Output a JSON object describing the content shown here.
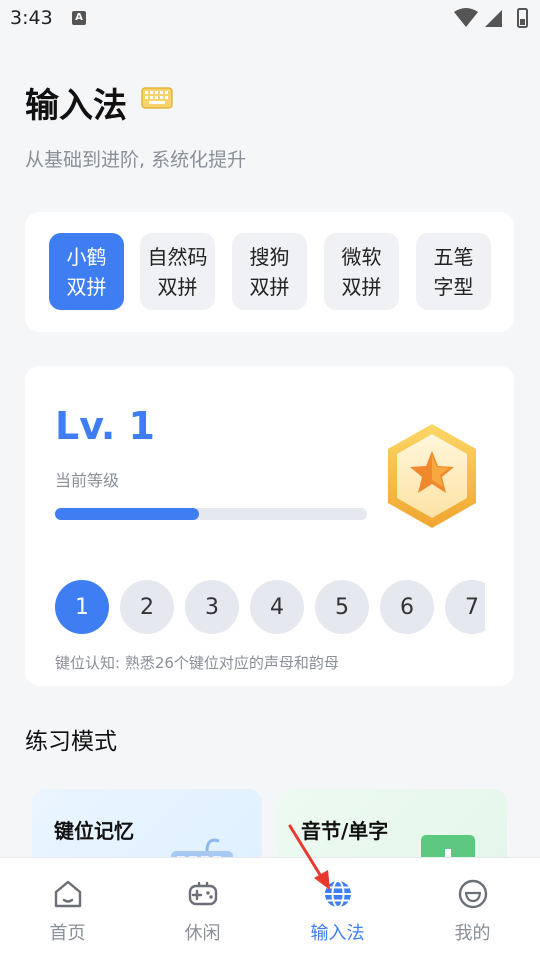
{
  "status_bar": {
    "time": "3:43",
    "notification_letter": "A"
  },
  "header": {
    "title": "输入法",
    "subtitle": "从基础到进阶, 系统化提升"
  },
  "schemes": [
    {
      "label": "小鹤\n双拼",
      "active": true
    },
    {
      "label": "自然码\n双拼",
      "active": false
    },
    {
      "label": "搜狗\n双拼",
      "active": false
    },
    {
      "label": "微软\n双拼",
      "active": false
    },
    {
      "label": "五笔\n字型",
      "active": false
    }
  ],
  "level": {
    "title": "Lv. 1",
    "subtitle": "当前等级",
    "progress": 0.46,
    "steps": [
      "1",
      "2",
      "3",
      "4",
      "5",
      "6",
      "7"
    ],
    "active_step": "1",
    "description": "键位认知: 熟悉26个键位对应的声母和韵母"
  },
  "practice": {
    "title": "练习模式",
    "modes": [
      {
        "title": "键位记忆"
      },
      {
        "title": "音节/单字"
      }
    ]
  },
  "nav": [
    {
      "label": "首页",
      "icon": "home-icon"
    },
    {
      "label": "休闲",
      "icon": "gamepad-icon"
    },
    {
      "label": "输入法",
      "icon": "globe-icon",
      "active": true
    },
    {
      "label": "我的",
      "icon": "smile-icon"
    }
  ],
  "colors": {
    "accent": "#3f7ef2",
    "badge_gold": "#f5b83a"
  }
}
